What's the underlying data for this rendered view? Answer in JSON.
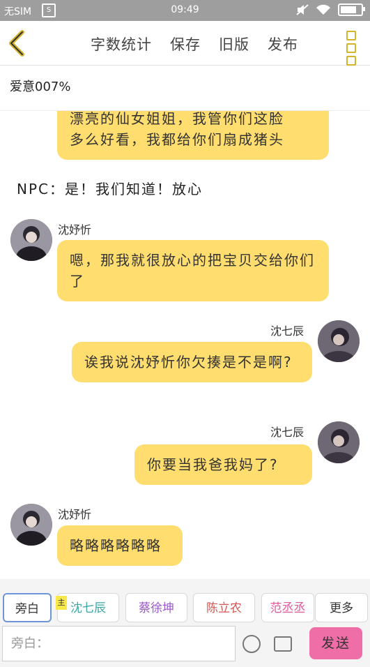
{
  "status": {
    "carrier": "无SIM",
    "sim_icon_label": "S",
    "time": "09:49",
    "battery_percent": 90
  },
  "toolbar": {
    "actions": [
      "字数统计",
      "保存",
      "旧版",
      "发布"
    ]
  },
  "title": "爱意007%",
  "messages": {
    "m0": {
      "text_lines": [
        "漂亮的仙女姐姐，我管你们这脸",
        "多么好看，我都给你们扇成猪头"
      ]
    },
    "narration": "NPC：是！我们知道！放心",
    "m1": {
      "name": "沈妤忻",
      "text": "嗯，那我就很放心的把宝贝交给你们了"
    },
    "m2": {
      "name": "沈七辰",
      "text": "诶我说沈妤忻你欠揍是不是啊?"
    },
    "m3": {
      "name": "沈七辰",
      "text": "你要当我爸我妈了?"
    },
    "m4": {
      "name": "沈妤忻",
      "text": "略略略略略略"
    }
  },
  "roles": [
    "旁白",
    "沈七辰",
    "蔡徐坤",
    "陈立农",
    "范丞丞",
    "更多"
  ],
  "role_colors": [
    "#333333",
    "#3aa6a6",
    "#9a5ac8",
    "#d9534f",
    "#e05a9a",
    "#333333"
  ],
  "main_badge": "主",
  "input": {
    "placeholder": "旁白："
  },
  "send_label": "发送"
}
